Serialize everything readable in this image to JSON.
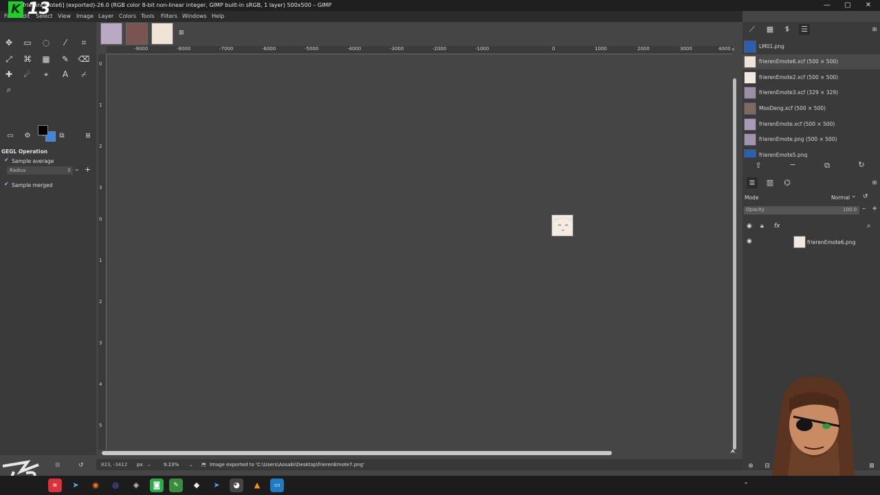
{
  "window": {
    "title": "[frierenEmote6] (exported)-26.0 (RGB color 8-bit non-linear integer, GIMP built-in sRGB, 1 layer) 500x500 – GIMP",
    "minimize": "—",
    "maximize": "▢",
    "close": "✕"
  },
  "overlay_logo": {
    "letter": "K",
    "number": "13"
  },
  "menubar": [
    "File",
    "Edit",
    "Select",
    "View",
    "Image",
    "Layer",
    "Colors",
    "Tools",
    "Filters",
    "Windows",
    "Help"
  ],
  "tool_options": {
    "title": "GEGL Operation",
    "sample_average_label": "Sample average",
    "radius_label": "Radius",
    "radius_value": "3",
    "sample_merged_label": "Sample merged"
  },
  "rulers": {
    "h_ticks": [
      "-9000",
      "-8000",
      "-7000",
      "-6000",
      "-5000",
      "-4000",
      "-3000",
      "-2000",
      "-1000",
      "0",
      "1000",
      "2000",
      "3000",
      "4000"
    ],
    "v_ticks": [
      "0",
      "1",
      "2",
      "3",
      "0",
      "1",
      "2",
      "3",
      "4",
      "5"
    ]
  },
  "statusbar": {
    "coords": "823, -3412",
    "unit": "px",
    "zoom": "9.23%",
    "message": "Image exported to 'C:\\Users\\Aosabi\\Desktop\\frierenEmote7.png'"
  },
  "images_panel": {
    "items": [
      {
        "label": "LM01.png"
      },
      {
        "label": "frierenEmote6.xcf (500 × 500)"
      },
      {
        "label": "frierenEmote2.xcf (500 × 500)"
      },
      {
        "label": "frierenEmote3.xcf (329 × 329)"
      },
      {
        "label": "MooDeng.xcf (500 × 500)"
      },
      {
        "label": "frierenEmote.xcf (500 × 500)"
      },
      {
        "label": "frierenEmote.png (500 × 500)"
      },
      {
        "label": "frierenEmote5.png"
      }
    ]
  },
  "layers_panel": {
    "mode_label": "Mode",
    "mode_value": "Normal",
    "opacity_label": "Opacity",
    "opacity_value": "100.0",
    "layer_name": "frierenEmote6.png"
  },
  "colors": {
    "fg": "#000000",
    "bg": "#3b86e4",
    "accent_green": "#1bd12a"
  }
}
